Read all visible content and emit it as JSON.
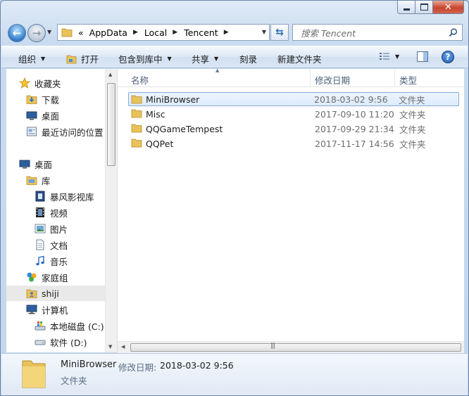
{
  "window": {
    "caption_buttons": [
      "minimize",
      "maximize",
      "close"
    ]
  },
  "nav": {
    "back_icon": "back-arrow-icon",
    "forward_icon": "forward-arrow-icon"
  },
  "address": {
    "overflow": "«",
    "crumbs": [
      "AppData",
      "Local",
      "Tencent"
    ]
  },
  "search": {
    "placeholder": "搜索 Tencent"
  },
  "toolbar": {
    "organize": "组织",
    "open": "打开",
    "include_in_library": "包含到库中",
    "share": "共享",
    "burn": "刻录",
    "new_folder": "新建文件夹"
  },
  "sidebar": {
    "favorites": "收藏夹",
    "downloads": "下载",
    "desktop_fav": "桌面",
    "recent": "最近访问的位置",
    "desktop": "桌面",
    "libraries": "库",
    "baofeng": "暴风影视库",
    "videos": "视频",
    "pictures": "图片",
    "documents": "文档",
    "music": "音乐",
    "homegroup": "家庭组",
    "user": "shiji",
    "computer": "计算机",
    "drive_c": "本地磁盘 (C:)",
    "drive_d": "软件 (D:)"
  },
  "columns": {
    "name": "名称",
    "date": "修改日期",
    "type": "类型"
  },
  "files": [
    {
      "name": "MiniBrowser",
      "date": "2018-03-02 9:56",
      "type": "文件夹"
    },
    {
      "name": "Misc",
      "date": "2017-09-10 11:20",
      "type": "文件夹"
    },
    {
      "name": "QQGameTempest",
      "date": "2017-09-29 21:34",
      "type": "文件夹"
    },
    {
      "name": "QQPet",
      "date": "2017-11-17 14:56",
      "type": "文件夹"
    }
  ],
  "details": {
    "name": "MiniBrowser",
    "date_label": "修改日期:",
    "date_value": "2018-03-02 9:56",
    "type": "文件夹"
  },
  "colors": {
    "accent": "#2f79c9",
    "selection_border": "#84acdd",
    "folder": "#e8c25a"
  }
}
